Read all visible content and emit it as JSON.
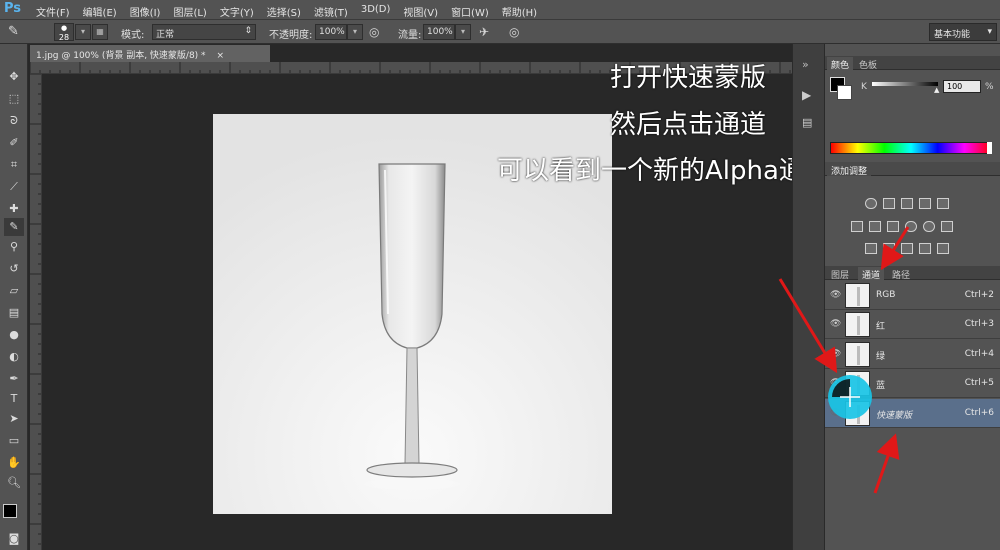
{
  "app": {
    "logo": "Ps"
  },
  "menu": [
    "文件(F)",
    "编辑(E)",
    "图像(I)",
    "图层(L)",
    "文字(Y)",
    "选择(S)",
    "滤镜(T)",
    "3D(D)",
    "视图(V)",
    "窗口(W)",
    "帮助(H)"
  ],
  "options": {
    "brush_size": "28",
    "mode_label": "模式:",
    "mode_value": "正常",
    "opacity_label": "不透明度:",
    "opacity_value": "100%",
    "flow_label": "流量:",
    "flow_value": "100%",
    "workspace": "基本功能"
  },
  "document": {
    "tab_title": "1.jpg @ 100% (背景 副本, 快速蒙版/8) *",
    "tab_close": "×"
  },
  "overlay": {
    "line1": "打开快速蒙版",
    "line2": "然后点击通道",
    "line3": "可以看到一个新的Alpha通道"
  },
  "color_panel": {
    "tabs": [
      "颜色",
      "色板"
    ],
    "channel_label": "K",
    "value": "100",
    "unit": "%"
  },
  "adjustments_panel": {
    "title": "添加调整"
  },
  "channels_panel": {
    "tabs": [
      "图层",
      "通道",
      "路径"
    ],
    "active_tab": "通道",
    "rows": [
      {
        "name": "RGB",
        "shortcut": "Ctrl+2"
      },
      {
        "name": "红",
        "shortcut": "Ctrl+3"
      },
      {
        "name": "绿",
        "shortcut": "Ctrl+4"
      },
      {
        "name": "蓝",
        "shortcut": "Ctrl+5"
      },
      {
        "name": "快速蒙版",
        "shortcut": "Ctrl+6"
      }
    ]
  },
  "colors": {
    "ui_panel": "#535353",
    "canvas_bg": "#282828",
    "selected_row": "#5a6f8b",
    "annotation_arrow": "#e01818",
    "cursor_highlight": "#19c4e6"
  }
}
